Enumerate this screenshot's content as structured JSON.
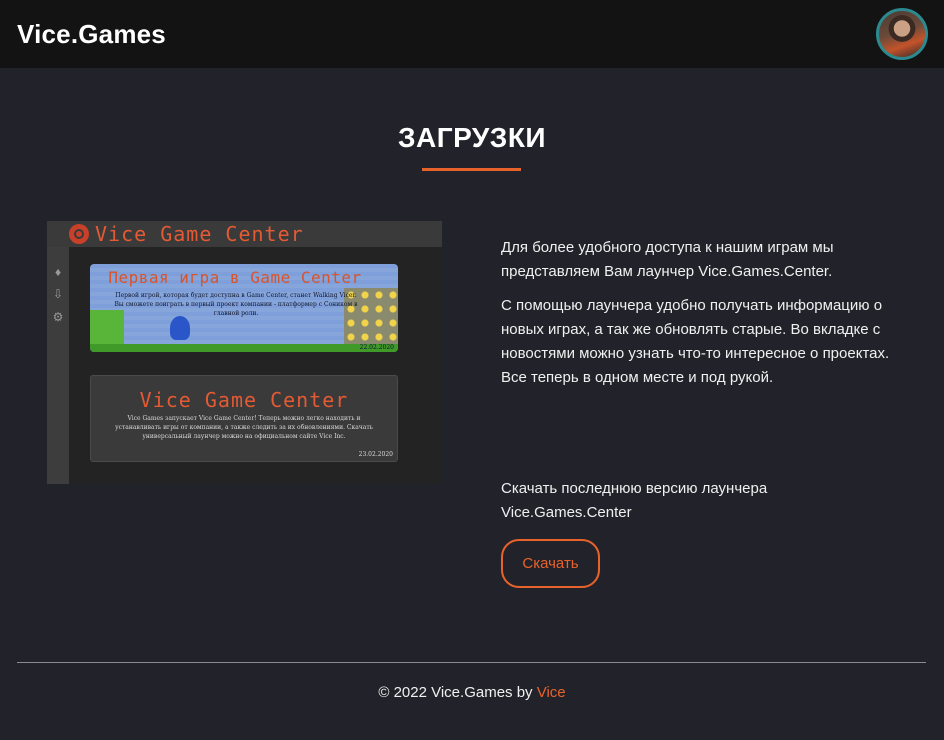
{
  "header": {
    "brand": "Vice.Games",
    "avatar_alt": "user avatar"
  },
  "main": {
    "title": "ЗАГРУЗКИ",
    "paragraphs": [
      "Для более удобного доступа к нашим играм мы представляем Вам лаунчер Vice.Games.Center.",
      "С помощью лаунчера удобно получать информацию о новых играх, а так же обновлять старые. Во вкладке с новостями можно узнать что-то интересное о проектах. Все теперь в одном месте и под рукой."
    ],
    "download_text": "Скачать последнюю версию лаунчера Vice.Games.Center",
    "download_button": "Скачать"
  },
  "launcher_preview": {
    "title": "Vice Game Center",
    "sidebar_icons": [
      "bell-icon",
      "download-icon",
      "gear-icon"
    ],
    "news": [
      {
        "title": "Первая игра в Game Center",
        "text": "Первой игрой, которая будет доступна в Game Center, станет Walking Vicer. Вы сможете поиграть в первый проект компании - платформер с Соником в главной роли.",
        "date": "22.02.2020"
      },
      {
        "title": "Vice Game Center",
        "text": "Vice Games запускает Vice Game Center! Теперь можно легко находить и устанавливать игры от компании, а также следить за их обновлениями. Скачать универсальный лаунчер можно на официальном сайте Vice Inc.",
        "date": "23.02.2020"
      }
    ]
  },
  "footer": {
    "copyright": "© 2022 Vice.Games by ",
    "author_link": "Vice"
  },
  "colors": {
    "accent": "#e8632b",
    "background": "#22222a",
    "header": "#131313"
  }
}
